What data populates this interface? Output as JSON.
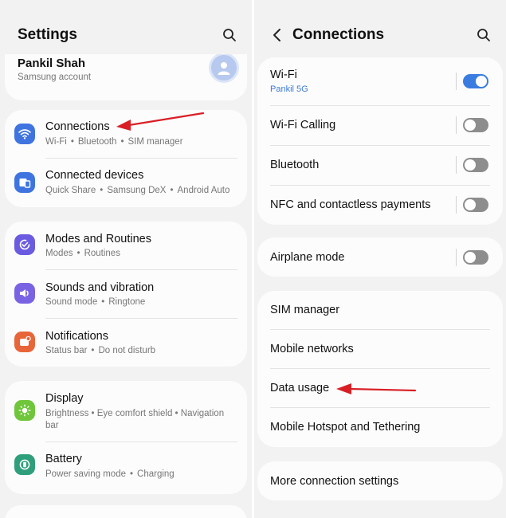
{
  "left": {
    "title": "Settings",
    "account": {
      "name": "Pankil Shah",
      "subtitle": "Samsung account"
    },
    "items": [
      {
        "label": "Connections",
        "subtitle": [
          "Wi-Fi",
          "Bluetooth",
          "SIM manager"
        ],
        "icon": "wifi-icon",
        "color": "#3f74e0"
      },
      {
        "label": "Connected devices",
        "subtitle": [
          "Quick Share",
          "Samsung DeX",
          "Android Auto"
        ],
        "icon": "devices-icon",
        "color": "#3f74e0"
      },
      {
        "label": "Modes and Routines",
        "subtitle": [
          "Modes",
          "Routines"
        ],
        "icon": "check-circle-icon",
        "color": "#6a5be0"
      },
      {
        "label": "Sounds and vibration",
        "subtitle": [
          "Sound mode",
          "Ringtone"
        ],
        "icon": "speaker-icon",
        "color": "#7a63e3"
      },
      {
        "label": "Notifications",
        "subtitle": [
          "Status bar",
          "Do not disturb"
        ],
        "icon": "bell-icon",
        "color": "#e8653a"
      },
      {
        "label": "Display",
        "subtitle_text": "Brightness • Eye comfort shield • Navigation bar",
        "icon": "sun-icon",
        "color": "#6fc63a"
      },
      {
        "label": "Battery",
        "subtitle": [
          "Power saving mode",
          "Charging"
        ],
        "icon": "battery-icon",
        "color": "#2f9e7a"
      }
    ]
  },
  "right": {
    "title": "Connections",
    "wifi": {
      "label": "Wi-Fi",
      "network": "Pankil 5G",
      "on": true
    },
    "wifi_calling": {
      "label": "Wi-Fi Calling",
      "on": false
    },
    "bluetooth": {
      "label": "Bluetooth",
      "on": false
    },
    "nfc": {
      "label": "NFC and contactless payments",
      "on": false
    },
    "airplane": {
      "label": "Airplane mode",
      "on": false
    },
    "sim": {
      "label": "SIM manager"
    },
    "mobile_networks": {
      "label": "Mobile networks"
    },
    "data_usage": {
      "label": "Data usage"
    },
    "hotspot": {
      "label": "Mobile Hotspot and Tethering"
    },
    "more": {
      "label": "More connection settings"
    }
  },
  "colors": {
    "accent": "#3b7ce0",
    "annotation_arrow": "#d91f26"
  }
}
